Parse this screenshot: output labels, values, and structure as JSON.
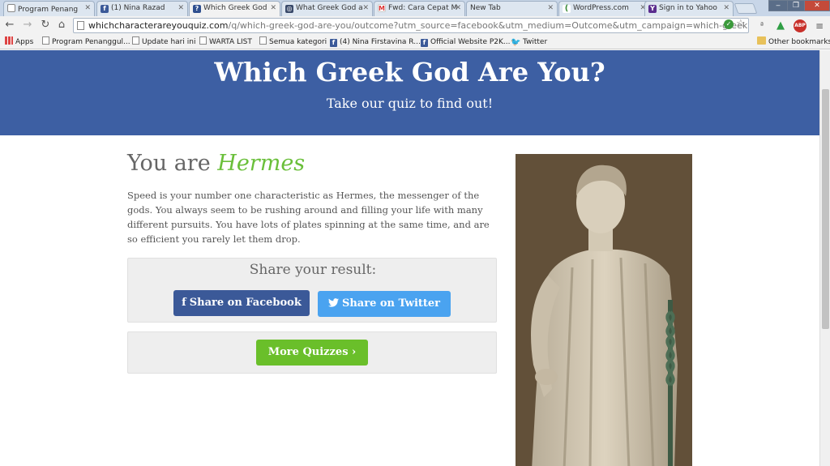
{
  "browser": {
    "tabs": [
      {
        "title": "Program Penang",
        "favicon": "page-icon"
      },
      {
        "title": "(1) Nina Razad",
        "favicon": "facebook-icon"
      },
      {
        "title": "Which Greek God",
        "favicon": "quiz-icon",
        "active": true
      },
      {
        "title": "What Greek God a",
        "favicon": "quiz-icon"
      },
      {
        "title": "Fwd: Cara Cepat M",
        "favicon": "gmail-icon"
      },
      {
        "title": "New Tab",
        "favicon": "none"
      },
      {
        "title": "WordPress.com",
        "favicon": "wordpress-icon"
      },
      {
        "title": "Sign in to Yahoo",
        "favicon": "yahoo-icon"
      }
    ],
    "address": {
      "host": "whichcharacterareyouquiz.com",
      "path": "/q/which-greek-god-are-you/outcome?utm_source=facebook&utm_medium=Outcome&utm_campaign=which-greek"
    },
    "extensions": [
      "translate-icon",
      "drive-icon",
      "adblock-icon",
      "menu-icon"
    ],
    "adblock_label": "ABP",
    "bookmarks": [
      {
        "label": "Apps",
        "icon": "apps-icon"
      },
      {
        "label": "Program Penanggul...",
        "icon": "page-icon"
      },
      {
        "label": "Update hari ini",
        "icon": "page-icon"
      },
      {
        "label": "WARTA LIST",
        "icon": "page-icon"
      },
      {
        "label": "Semua kategori",
        "icon": "page-icon"
      },
      {
        "label": "(4) Nina Firstavina R...",
        "icon": "facebook-icon"
      },
      {
        "label": "Official Website P2K...",
        "icon": "facebook-icon"
      },
      {
        "label": "Twitter",
        "icon": "twitter-icon"
      }
    ],
    "other_bookmarks": "Other bookmarks"
  },
  "page": {
    "hero": {
      "title": "Which Greek God Are You?",
      "subtitle": "Take our quiz to find out!"
    },
    "result": {
      "prefix": "You are",
      "name": "Hermes",
      "description": "Speed is your number one characteristic as Hermes, the messenger of the gods. You always seem to be rushing around and filling your life with many different pursuits. You have lots of plates spinning at the same time, and are so efficient you rarely let them drop."
    },
    "share": {
      "title": "Share your result:",
      "facebook_label": "Share on Facebook",
      "twitter_label": "Share on Twitter"
    },
    "more_label": "More Quizzes",
    "colors": {
      "hero_bg": "#3d5fa3",
      "accent_green": "#6abf3a",
      "facebook_blue": "#3b5998",
      "twitter_blue": "#4aa3f0"
    }
  }
}
